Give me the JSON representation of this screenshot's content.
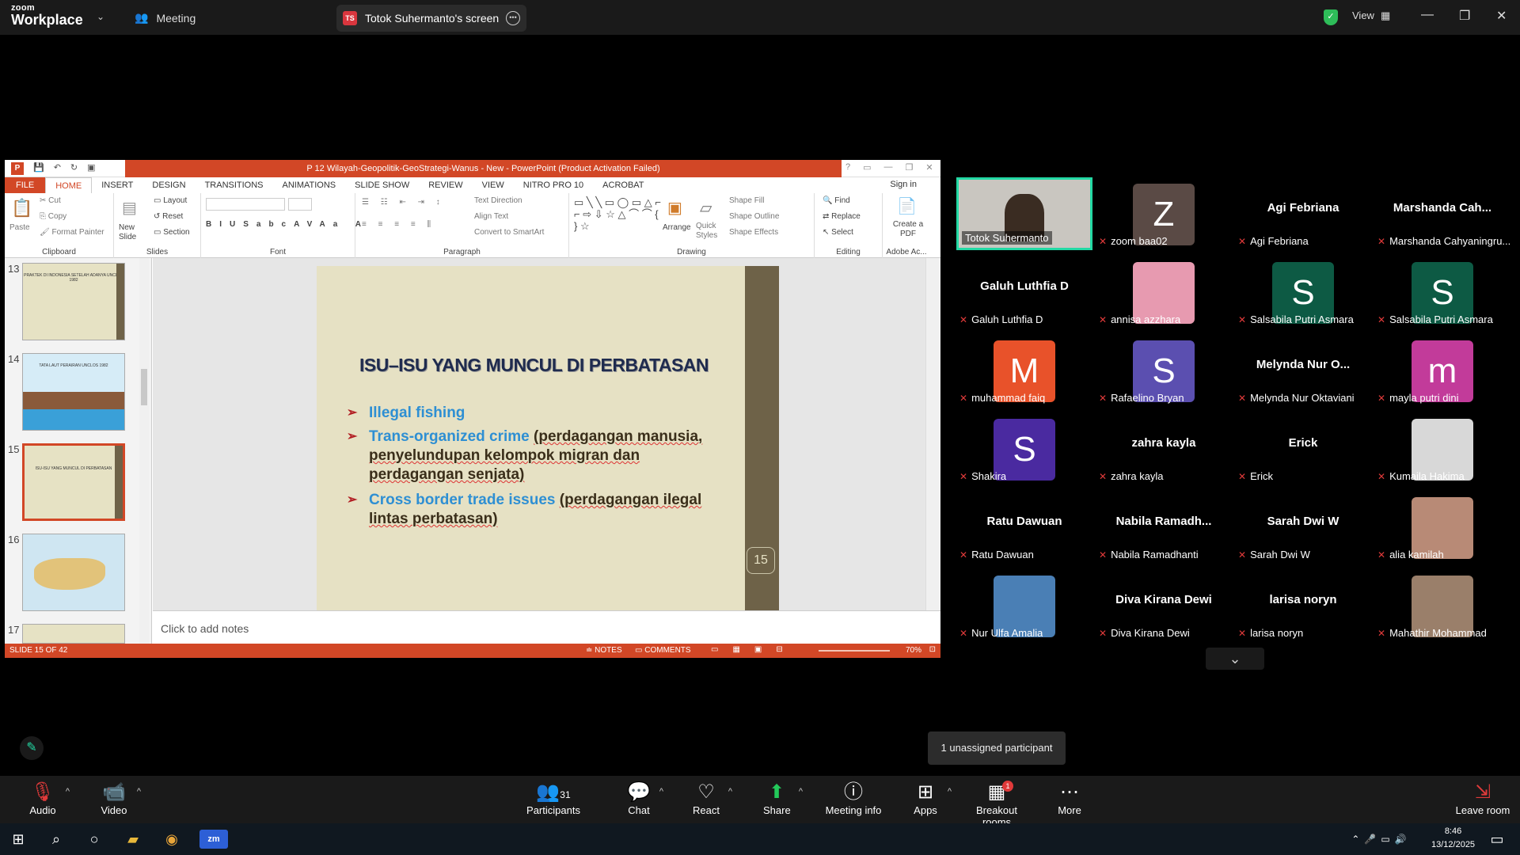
{
  "app": {
    "logo_line1": "zoom",
    "logo_line2": "Workplace",
    "meeting_label": "Meeting",
    "share_initials": "TS",
    "share_title": "Totok Suhermanto's screen",
    "view_label": "View"
  },
  "ppt": {
    "title": "P 12 Wilayah-Geopolitik-GeoStrategi-Wanus - New - PowerPoint (Product Activation Failed)",
    "tabs": [
      "FILE",
      "HOME",
      "INSERT",
      "DESIGN",
      "TRANSITIONS",
      "ANIMATIONS",
      "SLIDE SHOW",
      "REVIEW",
      "VIEW",
      "NITRO PRO 10",
      "ACROBAT"
    ],
    "signin": "Sign in",
    "groups": {
      "clipboard": "Clipboard",
      "slides": "Slides",
      "font": "Font",
      "paragraph": "Paragraph",
      "drawing": "Drawing",
      "editing": "Editing",
      "adobe": "Adobe Ac..."
    },
    "clip": {
      "paste": "Paste",
      "cut": "Cut",
      "copy": "Copy",
      "format_painter": "Format Painter"
    },
    "slides_g": {
      "new_slide": "New Slide",
      "layout": "Layout",
      "reset": "Reset",
      "section": "Section"
    },
    "para": {
      "text_direction": "Text Direction",
      "align_text": "Align Text",
      "convert": "Convert to SmartArt"
    },
    "draw": {
      "arrange": "Arrange",
      "quick_styles": "Quick Styles",
      "fill": "Shape Fill",
      "outline": "Shape Outline",
      "effects": "Shape Effects"
    },
    "edit": {
      "find": "Find",
      "replace": "Replace",
      "select": "Select"
    },
    "adobe_btn": "Create a PDF",
    "thumbs": [
      {
        "num": "13",
        "title": "PRAKTEK DI INDONESIA SETELAH ADANYA UNCLOS 1982"
      },
      {
        "num": "14",
        "title": "TATA LAUT PERAIRAN UNCLOS 1982"
      },
      {
        "num": "15",
        "title": "ISU-ISU YANG MUNCUL DI PERBATASAN"
      },
      {
        "num": "16",
        "title": ""
      },
      {
        "num": "17",
        "title": ""
      }
    ],
    "slide": {
      "heading": "ISU–ISU YANG MUNCUL DI PERBATASAN",
      "b1": "Illegal fishing",
      "b2_hl": "Trans-organized crime",
      "b2_rest": "(perdagangan manusia, penyelundupan kelompok migran dan perdagangan senjata)",
      "b3_hl": "Cross border trade issues",
      "b3_rest": "(perdagangan ilegal lintas perbatasan)",
      "page": "15"
    },
    "notes_placeholder": "Click to add notes",
    "status": {
      "slide": "SLIDE 15 OF 42",
      "notes": "NOTES",
      "comments": "COMMENTS",
      "zoom": "70%"
    }
  },
  "participants": [
    {
      "name": "Totok Suhermanto",
      "label": "Totok Suhermanto",
      "type": "video"
    },
    {
      "name": "zoom baa02",
      "initial": "Z",
      "color": "#5a4a45",
      "type": "initial"
    },
    {
      "name": "Agi Febriana",
      "big": "Agi Febriana",
      "type": "text"
    },
    {
      "name": "Marshanda Cahyaningru...",
      "big": "Marshanda  Cah...",
      "type": "text"
    },
    {
      "name": "Galuh Luthfia D",
      "big": "Galuh Luthfia D",
      "type": "text"
    },
    {
      "name": "annisa azzhara",
      "type": "photo",
      "color": "#e79ab0"
    },
    {
      "name": "Salsabila Putri Asmara",
      "initial": "S",
      "color": "#0d5a44",
      "type": "initial"
    },
    {
      "name": "Salsabila Putri Asmara",
      "initial": "S",
      "color": "#0d5a44",
      "type": "initial"
    },
    {
      "name": "muhammad faiq",
      "initial": "M",
      "color": "#e8522a",
      "type": "initial"
    },
    {
      "name": "Rafaelino Bryan",
      "initial": "S",
      "color": "#5b4fb0",
      "type": "initial"
    },
    {
      "name": "Melynda Nur Oktaviani",
      "big": "Melynda  Nur  O...",
      "type": "text"
    },
    {
      "name": "mayla putri dini",
      "initial": "m",
      "color": "#c23b9a",
      "type": "initial"
    },
    {
      "name": "Shakira",
      "initial": "S",
      "color": "#4a2aa0",
      "type": "initial"
    },
    {
      "name": "zahra kayla",
      "big": "zahra kayla",
      "type": "text"
    },
    {
      "name": "Erick",
      "big": "Erick",
      "type": "text"
    },
    {
      "name": "Kumaila Hakima",
      "type": "photo",
      "color": "#d8d8d8"
    },
    {
      "name": "Ratu Dawuan",
      "big": "Ratu Dawuan",
      "type": "text"
    },
    {
      "name": "Nabila Ramadhanti",
      "big": "Nabila  Ramadh...",
      "type": "text"
    },
    {
      "name": "Sarah Dwi W",
      "big": "Sarah Dwi W",
      "type": "text"
    },
    {
      "name": "alia kamilah",
      "type": "photo",
      "color": "#b88a76"
    },
    {
      "name": "Nur Ulfa Amalia",
      "type": "photo",
      "color": "#4a7fb5"
    },
    {
      "name": "Diva Kirana Dewi",
      "big": "Diva Kirana Dewi",
      "type": "text"
    },
    {
      "name": "larisa noryn",
      "big": "larisa noryn",
      "type": "text"
    },
    {
      "name": "Mahathir Mohammad",
      "type": "photo",
      "color": "#9a7f6a"
    }
  ],
  "tooltip": "1 unassigned participant",
  "toolbar": {
    "audio": "Audio",
    "video": "Video",
    "participants": "Participants",
    "participants_count": "31",
    "chat": "Chat",
    "react": "React",
    "share": "Share",
    "meeting_info": "Meeting info",
    "apps": "Apps",
    "breakout": "Breakout rooms",
    "breakout_badge": "1",
    "more": "More",
    "leave": "Leave room"
  },
  "taskbar": {
    "time": "8:46",
    "date": "13/12/2025"
  },
  "colors": {
    "ppt_accent": "#d24726",
    "zoom_active": "#23d9a4",
    "slide_bg": "#e6e1c4",
    "bullet_blue": "#2e8fd3",
    "arrow_red": "#b21f24"
  }
}
